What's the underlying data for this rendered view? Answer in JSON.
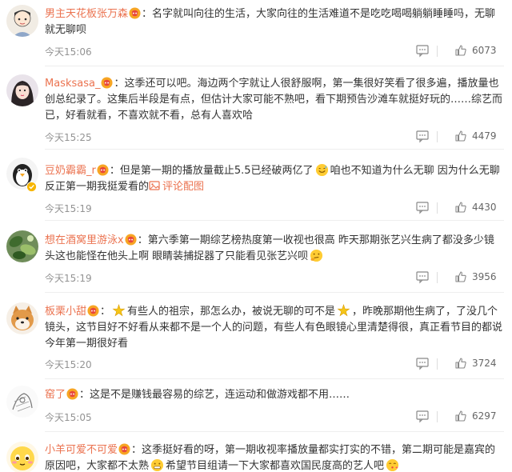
{
  "colors": {
    "username": "#eb7350",
    "meta": "#939393",
    "text": "#333333"
  },
  "comments": [
    {
      "username": "男主天花板张万森",
      "avatar_icon": "cartoon-boy-avatar-icon",
      "text_parts": [
        "名字就叫向往的生活，大家向往的生活难道不是吃吃喝喝躺躺睡睡吗，无聊就无聊呗"
      ],
      "time": "今天15:06",
      "likes": "6073"
    },
    {
      "username": "Masksasa_",
      "avatar_icon": "girl-avatar-icon",
      "text_parts": [
        "这季还可以吧。海边两个字就让人很舒服啊，第一集很好笑看了很多遍，播放量也创总纪录了。这集后半段是有点，但估计大家可能不熟吧，看下期预告沙滩车就挺好玩的……综艺而已，好看就看，不喜欢就不看，总有人喜欢哈"
      ],
      "time": "今天15:25",
      "likes": "4479"
    },
    {
      "username": "豆奶霸霸_r",
      "avatar_icon": "penguin-avatar-icon",
      "text_parts": [
        "但是第一期的播放量截止5.5已经破两亿了",
        "咱也不知道为什么无聊 因为什么无聊 反正第一期我挺爱看的"
      ],
      "pic_link": "评论配图",
      "time": "今天15:19",
      "likes": "4430"
    },
    {
      "username": "想在酒窝里游泳x",
      "avatar_icon": "green-leaf-avatar-icon",
      "text_parts": [
        "第六季第一期综艺榜热度第一收视也很高 昨天那期张艺兴生病了都没多少镜头这也能怪在他头上啊 眼睛装捕捉器了只能看见张艺兴呗"
      ],
      "time": "今天15:19",
      "likes": "3956"
    },
    {
      "username": "板栗小甜",
      "avatar_icon": "shiba-avatar-icon",
      "text_parts": [
        "有些人的祖宗，那怎么办，被说无聊的可不是",
        "，昨晚那期他生病了，了没几个镜头，这节目好不好看从来都不是一个人的问题，有些人有色眼镜心里清楚得很，真正看节目的都说今年第一期很好看"
      ],
      "time": "今天15:20",
      "likes": "3724"
    },
    {
      "username": "窑了",
      "avatar_icon": "sketch-avatar-icon",
      "text_parts": [
        "这是不是赚钱最容易的综艺，连运动和做游戏都不用……"
      ],
      "time": "今天15:05",
      "likes": "6297"
    },
    {
      "username": "小羊可爱不可爱",
      "avatar_icon": "cute-face-avatar-icon",
      "text_parts": [
        "这季挺好看的呀，第一期收视率播放量都实打实的不错，第二期可能是嘉宾的原因吧，大家都不太熟",
        "希望节目组请一下大家都喜欢国民度高的艺人吧"
      ],
      "time": "",
      "likes": ""
    }
  ]
}
